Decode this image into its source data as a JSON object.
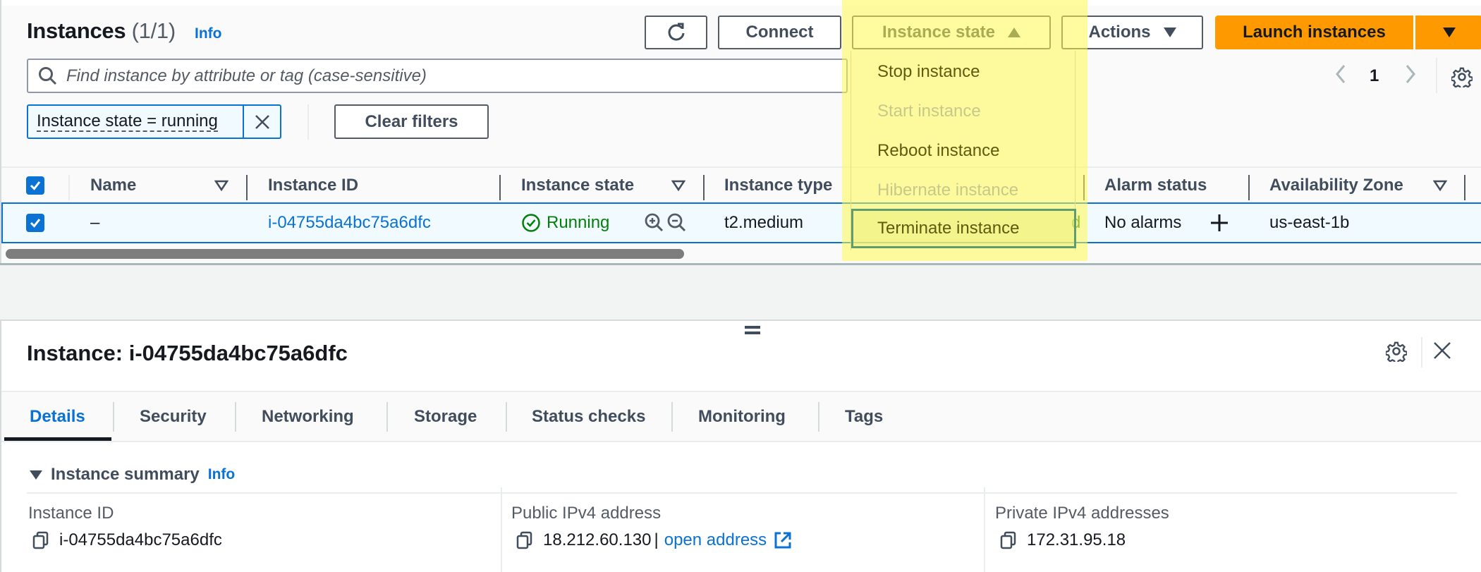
{
  "header": {
    "title": "Instances",
    "count": "(1/1)",
    "info_label": "Info"
  },
  "toolbar": {
    "refresh_icon": "refresh-icon",
    "connect_label": "Connect",
    "instance_state_label": "Instance state",
    "actions_label": "Actions",
    "launch_label": "Launch instances"
  },
  "search": {
    "placeholder": "Find instance by attribute or tag (case-sensitive)",
    "value": ""
  },
  "filters": {
    "chip_label": "Instance state = running",
    "clear_label": "Clear filters"
  },
  "pagination": {
    "current_page": "1"
  },
  "instance_state_menu": {
    "items": [
      {
        "label": "Stop instance",
        "disabled": false
      },
      {
        "label": "Start instance",
        "disabled": true
      },
      {
        "label": "Reboot instance",
        "disabled": false
      },
      {
        "label": "Hibernate instance",
        "disabled": true
      },
      {
        "label": "Terminate instance",
        "disabled": false,
        "focused": true
      }
    ]
  },
  "table": {
    "columns": [
      "Name",
      "Instance ID",
      "Instance state",
      "Instance type",
      "Alarm status",
      "Availability Zone"
    ],
    "rows": [
      {
        "selected": true,
        "name": "–",
        "instance_id": "i-04755da4bc75a6dfc",
        "instance_state": "Running",
        "instance_type": "t2.medium",
        "status_check_partial": "d",
        "alarm_status": "No alarms",
        "availability_zone": "us-east-1b"
      }
    ]
  },
  "detail": {
    "title": "Instance: i-04755da4bc75a6dfc",
    "tabs": [
      "Details",
      "Security",
      "Networking",
      "Storage",
      "Status checks",
      "Monitoring",
      "Tags"
    ],
    "active_tab": "Details",
    "summary_title": "Instance summary",
    "summary_info": "Info",
    "fields": {
      "instance_id_label": "Instance ID",
      "instance_id_value": "i-04755da4bc75a6dfc",
      "public_ipv4_label": "Public IPv4 address",
      "public_ipv4_value": "18.212.60.130",
      "separator": "|",
      "open_address_label": "open address",
      "private_ipv4_label": "Private IPv4 addresses",
      "private_ipv4_value": "172.31.95.18"
    }
  },
  "colors": {
    "accent": "#0972d3",
    "primary_button": "#ff9900",
    "running": "#037f0c",
    "highlight": "#fff950"
  }
}
